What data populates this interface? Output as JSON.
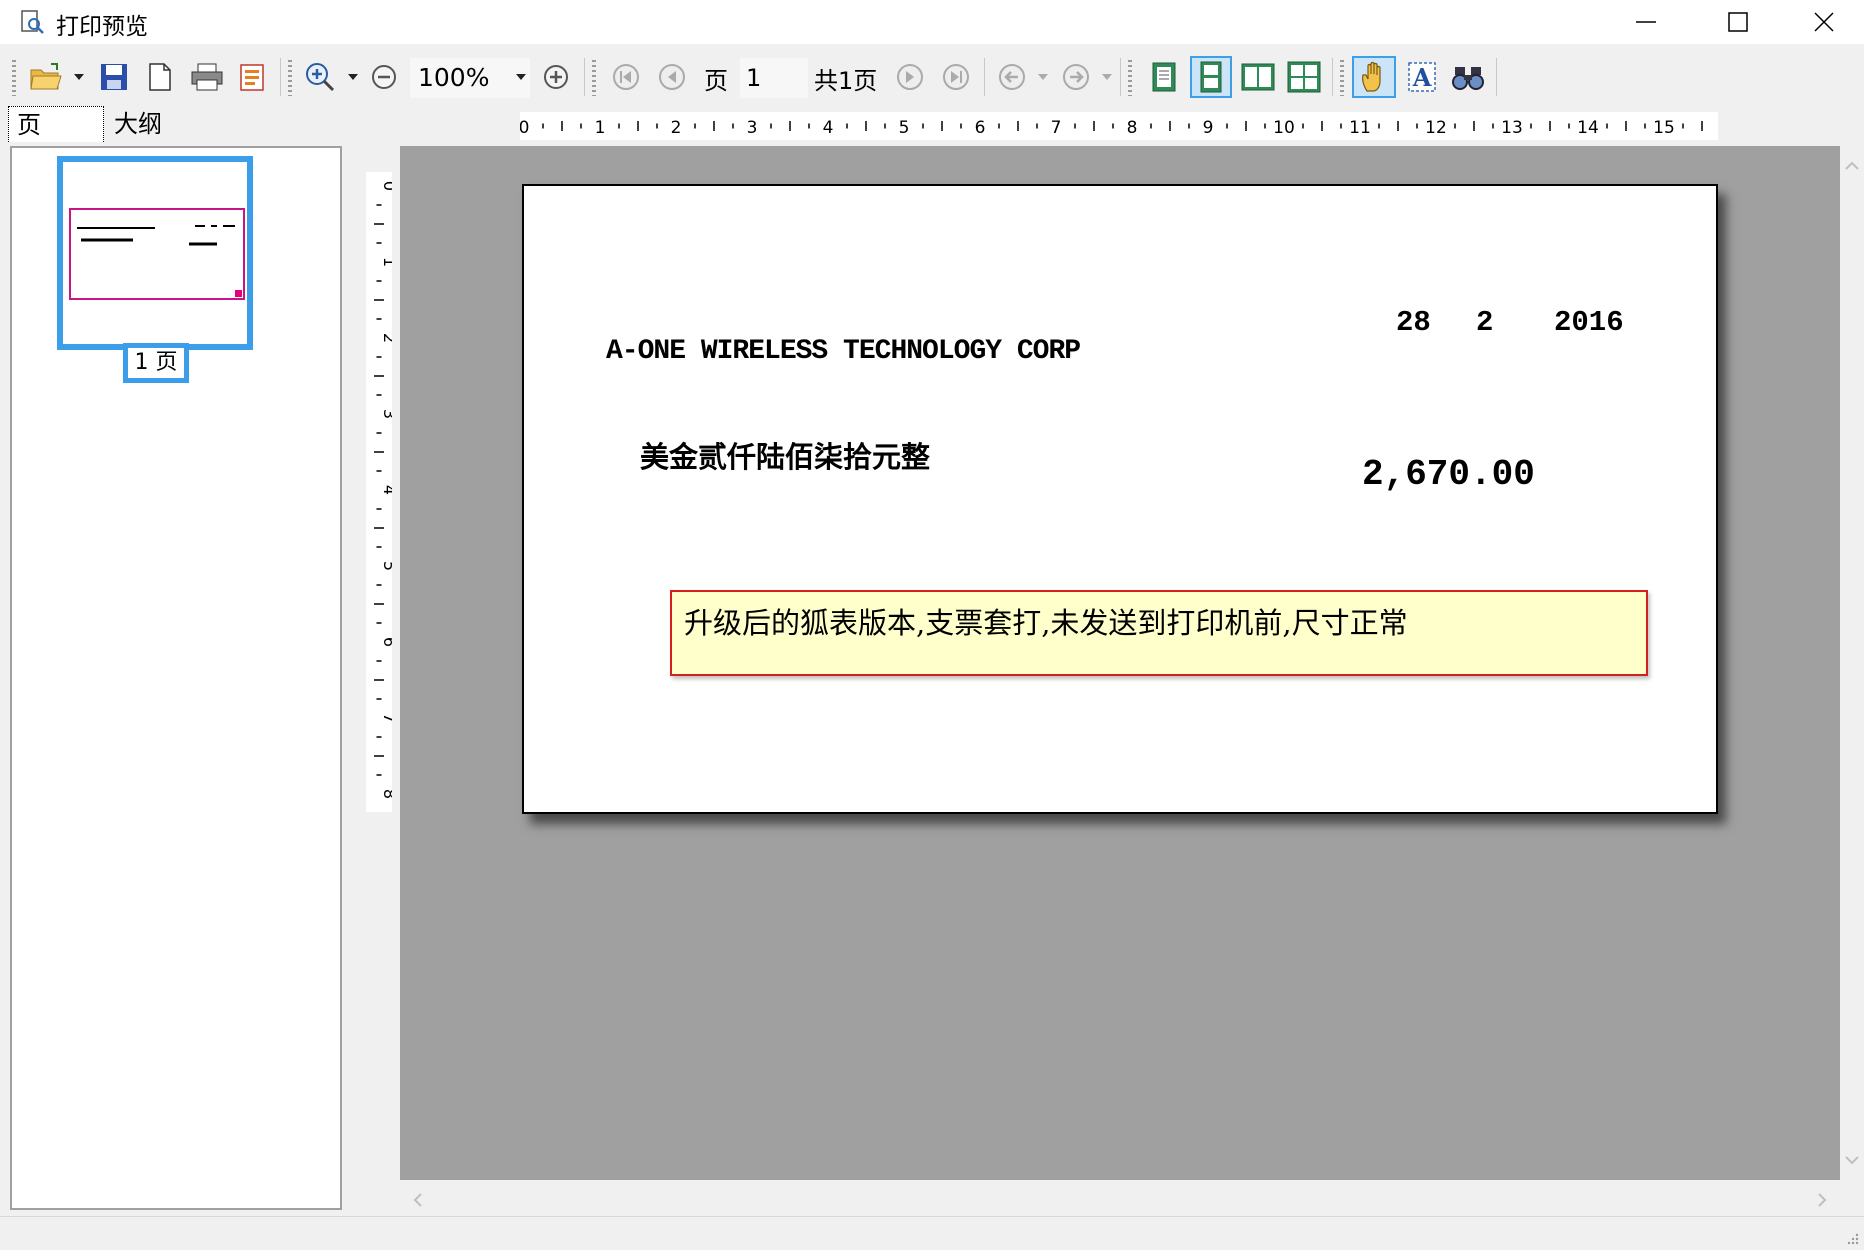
{
  "window": {
    "title": "打印预览",
    "controls": [
      "minimize",
      "maximize",
      "close"
    ]
  },
  "toolbar": {
    "zoom_value": "100%",
    "page_label": "页",
    "page_number": "1",
    "total_pages": "共1页",
    "icons": [
      "open-icon",
      "save-icon",
      "page-setup-icon",
      "print-icon",
      "export-icon",
      "zoom-in-icon",
      "zoom-out-icon",
      "zoom-reset-icon",
      "first-page-icon",
      "prev-page-icon",
      "next-page-icon",
      "last-page-icon",
      "back-icon",
      "forward-icon",
      "single-page-icon",
      "continuous-page-icon",
      "two-page-icon",
      "multi-page-icon",
      "hand-tool-icon",
      "text-select-icon",
      "find-icon"
    ]
  },
  "side_panel": {
    "tabs": [
      {
        "label": "页"
      },
      {
        "label": "大纲"
      }
    ],
    "thumbnail_label": "1 页"
  },
  "rulers": {
    "horizontal": [
      "0",
      "1",
      "2",
      "3",
      "4",
      "5",
      "6",
      "7",
      "8",
      "9",
      "10",
      "11",
      "12",
      "13",
      "14",
      "15"
    ],
    "vertical": [
      "0",
      "1",
      "2",
      "3",
      "4",
      "5",
      "6",
      "7",
      "8"
    ]
  },
  "check": {
    "payee": "A-ONE WIRELESS TECHNOLOGY CORP",
    "date_day": "28",
    "date_month": "2",
    "date_year": "2016",
    "amount_words": "美金贰仟陆佰柒拾元整",
    "amount": "2,670.00",
    "annotation": "升级后的狐表版本,支票套打,未发送到打印机前,尺寸正常"
  },
  "colors": {
    "accent": "#3c9ee8",
    "preview_bg": "#a0a0a0",
    "note_bg": "#ffffcc",
    "note_border": "#d02020",
    "thumb_border": "#c71585"
  }
}
